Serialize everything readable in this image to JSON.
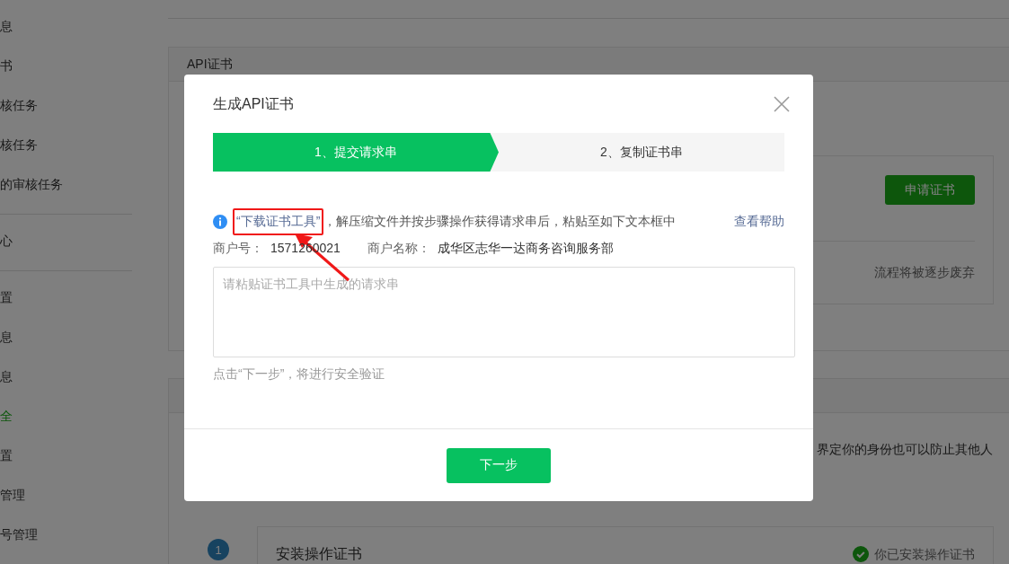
{
  "sidebar": {
    "items": [
      {
        "label": "息",
        "selected": false
      },
      {
        "label": "书",
        "selected": false
      },
      {
        "label": "核任务",
        "selected": false
      },
      {
        "label": "核任务",
        "selected": false
      },
      {
        "label": "的审核任务",
        "selected": false
      },
      {
        "label": "心",
        "selected": false
      },
      {
        "label": "置",
        "selected": false
      },
      {
        "label": "息",
        "selected": false
      },
      {
        "label": "息",
        "selected": false
      },
      {
        "label": "全",
        "selected": true
      },
      {
        "label": "置",
        "selected": false
      },
      {
        "label": "管理",
        "selected": false
      },
      {
        "label": "号管理",
        "selected": false
      }
    ]
  },
  "api_card": {
    "title": "API证书",
    "apply_button": "申请证书",
    "notice": "流程将被逐步废弃"
  },
  "second_card": {
    "text": "界定你的身份也可以防止其他人"
  },
  "install_step": {
    "number": "1",
    "title": "安装操作证书",
    "status": "你已安装操作证书"
  },
  "modal": {
    "title": "生成API证书",
    "steps": [
      {
        "label": "1、提交请求串",
        "selected": true
      },
      {
        "label": "2、复制证书串",
        "selected": false
      }
    ],
    "info_link": "“下载证书工具”",
    "info_text": "，解压缩文件并按步骤操作获得请求串后，粘贴至如下文本框中",
    "help_link": "查看帮助",
    "merchant_id_label": "商户号：",
    "merchant_id": "1571260021",
    "merchant_name_label": "商户名称：",
    "merchant_name": "成华区志华一达商务咨询服务部",
    "textarea": {
      "placeholder": "请粘贴证书工具中生成的请求串"
    },
    "hint": "点击“下一步”，将进行安全验证",
    "next_button": "下一步"
  }
}
